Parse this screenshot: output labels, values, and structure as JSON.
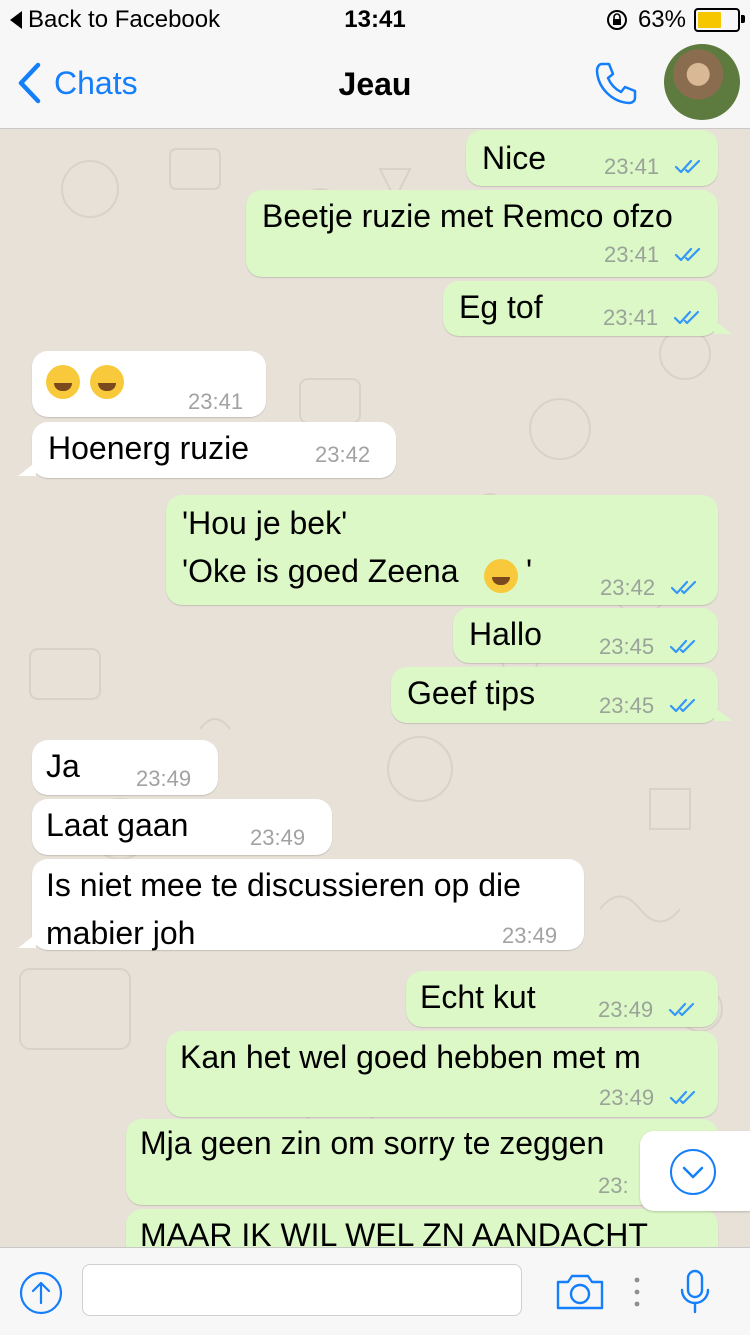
{
  "status_bar": {
    "back_label": "Back to Facebook",
    "time": "13:41",
    "battery": "63%",
    "battery_level": 0.63,
    "battery_color": "#f6c700"
  },
  "nav": {
    "back_label": "Chats",
    "title": "Jeau",
    "call_icon": "phone-icon",
    "avatar": "contact-avatar"
  },
  "colors": {
    "accent": "#147efb",
    "outgoing_bubble": "#dcf8c6",
    "incoming_bubble": "#ffffff",
    "read_ticks": "#3497f9"
  },
  "messages": [
    {
      "dir": "out",
      "text": "Nice",
      "time": "23:41"
    },
    {
      "dir": "out",
      "text": "Beetje ruzie met Remco ofzo",
      "time": "23:41"
    },
    {
      "dir": "out",
      "text": "Eg tof",
      "time": "23:41"
    },
    {
      "dir": "in",
      "text": "",
      "emoji": [
        "face-with-tears-of-joy",
        "face-with-tears-of-joy"
      ],
      "time": "23:41"
    },
    {
      "dir": "in",
      "text": "Hoenerg ruzie",
      "time": "23:42"
    },
    {
      "dir": "out",
      "lines": [
        "'Hou je bek'",
        "'Oke is goed Zeena",
        "'"
      ],
      "emoji": "smiling-face",
      "time": "23:42"
    },
    {
      "dir": "out",
      "text": "Hallo",
      "time": "23:45"
    },
    {
      "dir": "out",
      "text": "Geef tips",
      "time": "23:45"
    },
    {
      "dir": "in",
      "text": "Ja",
      "time": "23:49"
    },
    {
      "dir": "in",
      "text": "Laat gaan",
      "time": "23:49"
    },
    {
      "dir": "in",
      "lines": [
        "Is niet mee te discussieren op die",
        "mabier joh"
      ],
      "time": "23:49"
    },
    {
      "dir": "out",
      "text": "Echt kut",
      "time": "23:49"
    },
    {
      "dir": "out",
      "text": "Kan het wel goed hebben met m",
      "time": "23:49"
    },
    {
      "dir": "out",
      "text": "Mja geen zin om sorry te zeggen",
      "time": "23:"
    },
    {
      "dir": "out",
      "text": "MAAR IK WIL WEL ZN AANDACHT",
      "time": ""
    }
  ],
  "input": {
    "placeholder": "",
    "value": ""
  },
  "toolbar": {
    "share_icon": "arrow-up-icon",
    "camera_icon": "camera-icon",
    "more_icon": "more-dots-icon",
    "mic_icon": "microphone-icon",
    "scroll_icon": "chevron-down-icon"
  }
}
